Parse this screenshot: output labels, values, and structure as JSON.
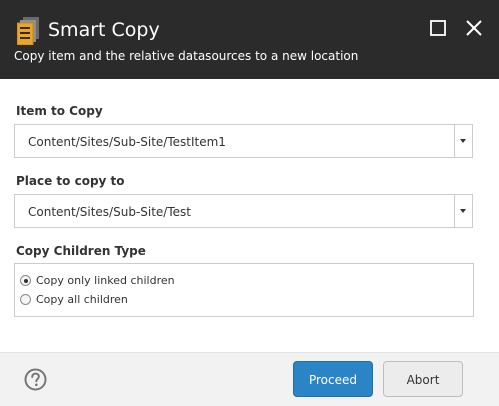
{
  "header": {
    "title": "Smart Copy",
    "subtitle": "Copy item and the relative datasources to a new location",
    "background_color": "#2b2b2b",
    "icon": "app-icon-document-stack",
    "window_controls": [
      "maximize-icon",
      "close-icon"
    ]
  },
  "form": {
    "item_to_copy": {
      "label": "Item to Copy",
      "value": "Content/Sites/Sub-Site/TestItem1"
    },
    "place_to_copy": {
      "label": "Place to copy to",
      "value": "Content/Sites/Sub-Site/Test"
    },
    "children_type": {
      "label": "Copy Children Type",
      "options": [
        {
          "label": "Copy only linked children",
          "selected": true
        },
        {
          "label": "Copy all children",
          "selected": false
        }
      ]
    }
  },
  "footer": {
    "help_icon": "help-icon",
    "proceed_label": "Proceed",
    "abort_label": "Abort",
    "primary_color": "#2b84c5"
  }
}
